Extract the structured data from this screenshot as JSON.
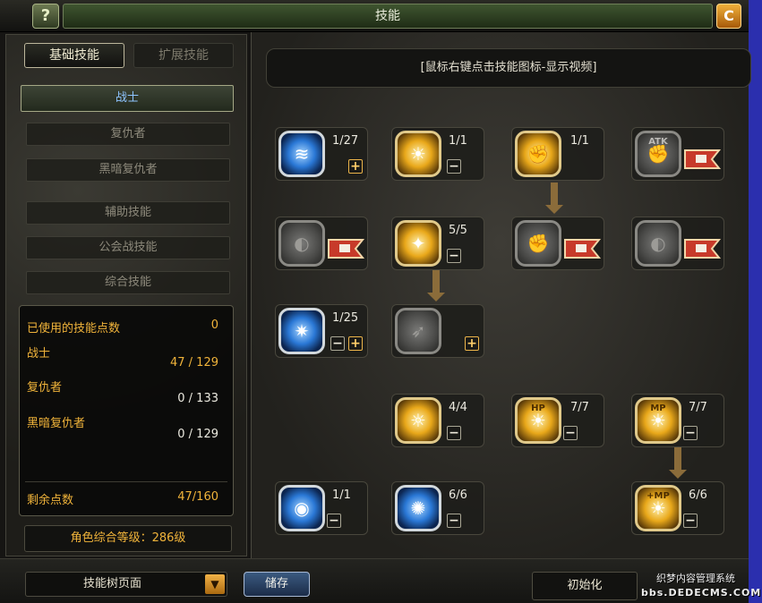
{
  "window": {
    "title": "技能",
    "help_label": "?",
    "close_label": "C"
  },
  "tabs": {
    "basic": "基础技能",
    "extended": "扩展技能"
  },
  "categories": {
    "warrior": "战士",
    "avenger": "复仇者",
    "dark_avenger": "黑暗复仇者",
    "support": "辅助技能",
    "guild_war": "公会战技能",
    "general": "综合技能"
  },
  "stats": {
    "used_label": "已使用的技能点数",
    "used_value": "0",
    "warrior_label": "战士",
    "warrior_value": "47 / 129",
    "avenger_label": "复仇者",
    "avenger_value": "0 / 133",
    "dark_avenger_label": "黑暗复仇者",
    "dark_avenger_value": "0 / 129",
    "remaining_label": "剩余点数",
    "remaining_value": "47/160"
  },
  "character_level": "角色综合等级：286级",
  "bottom": {
    "dropdown_value": "技能树页面",
    "dropdown_arrow": "▼",
    "save_label": "储存",
    "init_label": "初始化",
    "watermark_line1": "织梦内容管理系统",
    "watermark_line2": "bbs.DEDECMS.COM"
  },
  "hint": "[鼠标右键点击技能图标-显示视频]",
  "skills": {
    "s1": {
      "level": "1/27",
      "plus": "+"
    },
    "s2": {
      "level": "1/1",
      "minus": "−"
    },
    "s3": {
      "level": "1/1"
    },
    "s4": {
      "tag": "ATK"
    },
    "s6": {
      "level": "5/5",
      "minus": "−"
    },
    "s9": {
      "level": "1/25",
      "minus": "−",
      "plus": "+"
    },
    "s10": {
      "plus": "+"
    },
    "s11": {
      "level": "4/4",
      "minus": "−"
    },
    "s12": {
      "tag": "HP",
      "level": "7/7",
      "minus": "−"
    },
    "s13": {
      "tag": "MP",
      "level": "7/7",
      "minus": "−"
    },
    "s14": {
      "level": "1/1",
      "minus": "−"
    },
    "s15": {
      "level": "6/6",
      "minus": "−"
    },
    "s16": {
      "tag": "+MP",
      "level": "6/6",
      "minus": "−"
    }
  },
  "icons": {
    "blue_frame": "#d2d8dc",
    "gold_frame": "#e0c98a",
    "locked_frame": "#8a8984"
  }
}
